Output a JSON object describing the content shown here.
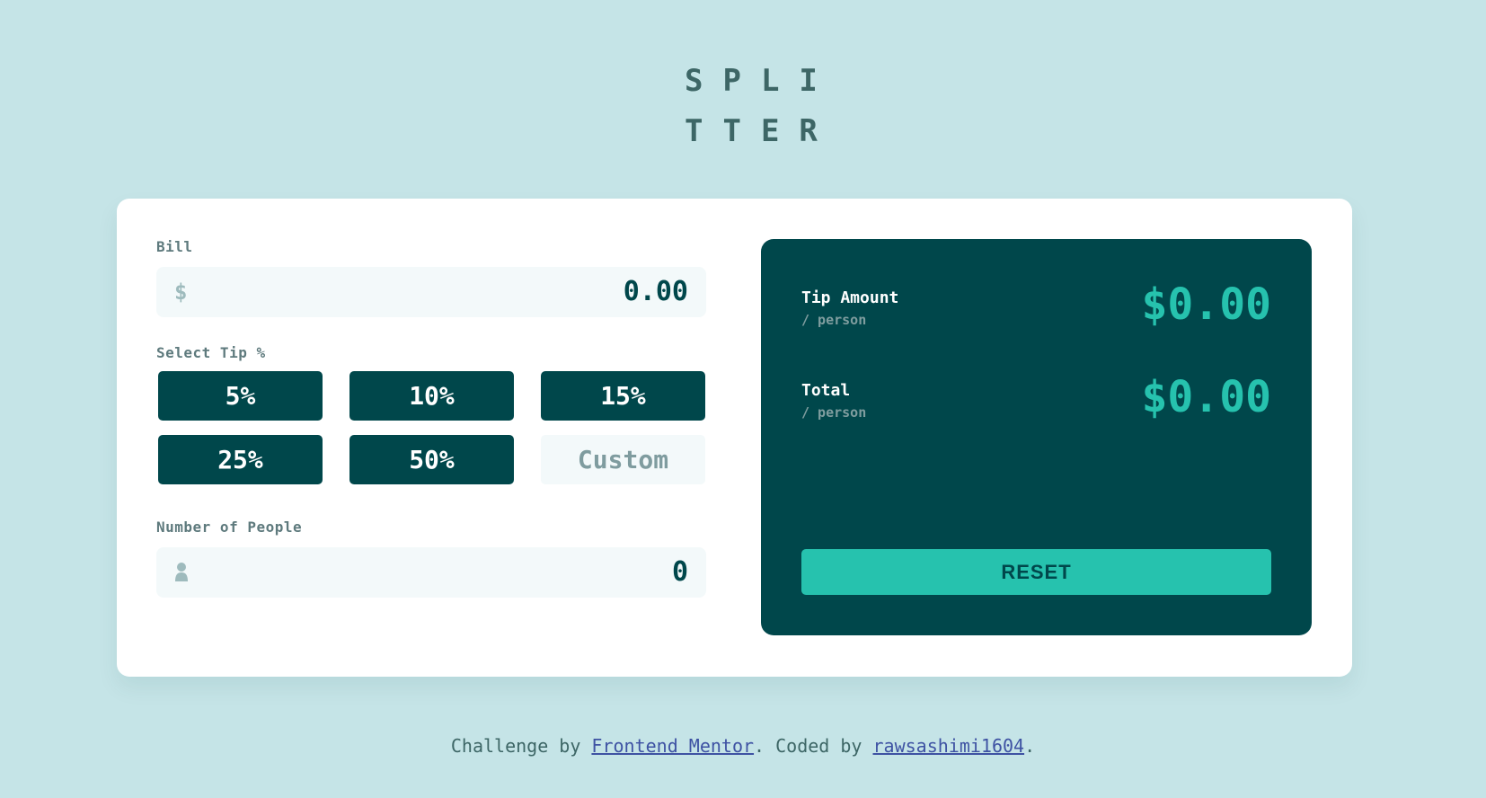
{
  "logo": {
    "line1": "SPLI",
    "line2": "TTER"
  },
  "form": {
    "bill_label": "Bill",
    "bill_prefix": "$",
    "bill_value": "0.00",
    "tip_label": "Select Tip %",
    "tips": [
      "5%",
      "10%",
      "15%",
      "25%",
      "50%"
    ],
    "custom_placeholder": "Custom",
    "people_label": "Number of People",
    "people_value": "0"
  },
  "results": {
    "tip_title": "Tip Amount",
    "tip_sub": "/ person",
    "tip_value": "$0.00",
    "total_title": "Total",
    "total_sub": "/ person",
    "total_value": "$0.00",
    "reset_label": "RESET"
  },
  "footer": {
    "prefix": "Challenge by ",
    "link1": "Frontend Mentor",
    "middle": ". Coded by ",
    "link2": "rawsashimi1604",
    "suffix": "."
  },
  "colors": {
    "background": "#c5e4e7",
    "dark_cyan": "#00474b",
    "accent": "#26c2ae"
  }
}
